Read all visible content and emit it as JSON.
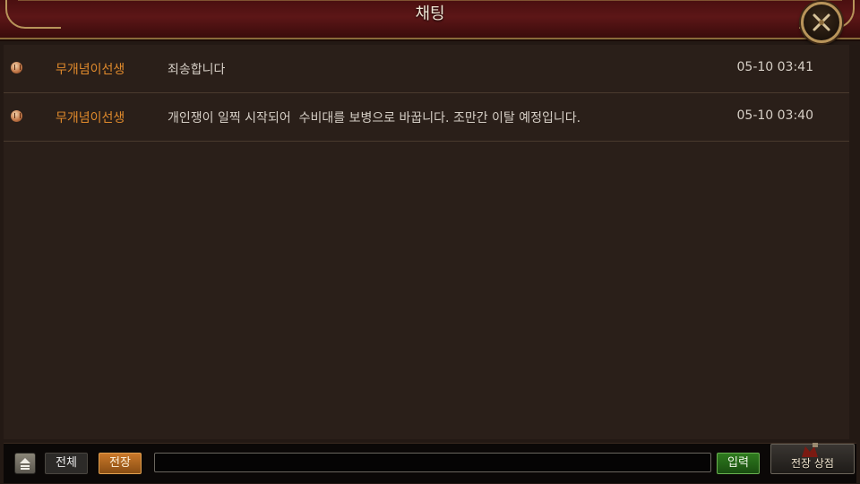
{
  "window": {
    "title": "채팅"
  },
  "messages": [
    {
      "user": "무개념이선생",
      "text": "죄송합니다",
      "time": "05-10 03:41"
    },
    {
      "user": "무개념이선생",
      "text": "개인쟁이 일찍 시작되어  수비대를 보병으로 바꿉니다. 조만간 이탈 예정입니다.",
      "time": "05-10 03:40"
    }
  ],
  "bottom_bar": {
    "tab_all": "전체",
    "tab_battlefield": "전장",
    "input_value": "",
    "send_label": "입력",
    "shop_label": "전장 상점"
  },
  "colors": {
    "username": "#e08a2c",
    "header": "#5c1617",
    "active_tab": "#c9782a",
    "send_button": "#2e7a1e"
  }
}
